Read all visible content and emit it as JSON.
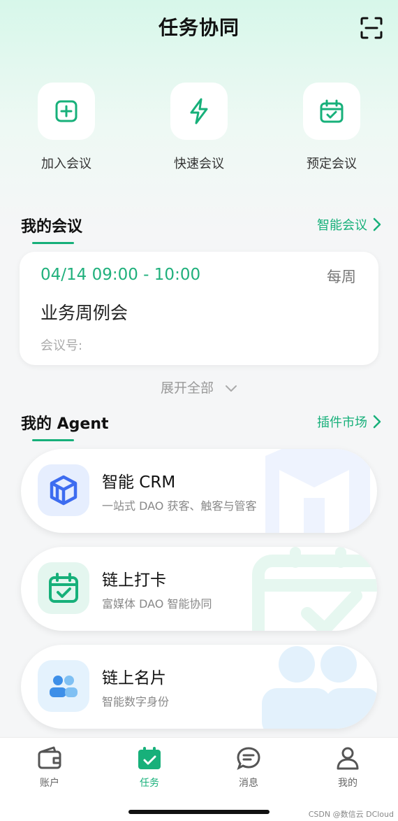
{
  "header": {
    "title": "任务协同"
  },
  "quick_actions": [
    {
      "label": "加入会议",
      "icon": "add-square-icon"
    },
    {
      "label": "快速会议",
      "icon": "lightning-icon"
    },
    {
      "label": "预定会议",
      "icon": "calendar-check-icon"
    }
  ],
  "my_meetings": {
    "title": "我的会议",
    "link": "智能会议",
    "meeting": {
      "time": "04/14 09:00 - 10:00",
      "repeat": "每周",
      "name": "业务周例会",
      "id_label": "会议号:"
    },
    "expand": "展开全部"
  },
  "my_agents": {
    "title": "我的 Agent",
    "link": "插件市场",
    "items": [
      {
        "name": "智能 CRM",
        "desc": "一站式 DAO 获客、触客与管客",
        "icon": "cube-icon"
      },
      {
        "name": "链上打卡",
        "desc": "富媒体 DAO 智能协同",
        "icon": "calendar-check-icon"
      },
      {
        "name": "链上名片",
        "desc": "智能数字身份",
        "icon": "people-icon"
      }
    ]
  },
  "tabbar": [
    {
      "label": "账户",
      "icon": "wallet-icon",
      "active": false
    },
    {
      "label": "任务",
      "icon": "calendar-check-icon",
      "active": true
    },
    {
      "label": "消息",
      "icon": "chat-icon",
      "active": false
    },
    {
      "label": "我的",
      "icon": "user-icon",
      "active": false
    }
  ],
  "watermark": "CSDN @数信云 DCloud",
  "colors": {
    "accent": "#17b07a",
    "crm_blue": "#3d6cf0",
    "people_blue": "#3aa0ef"
  }
}
